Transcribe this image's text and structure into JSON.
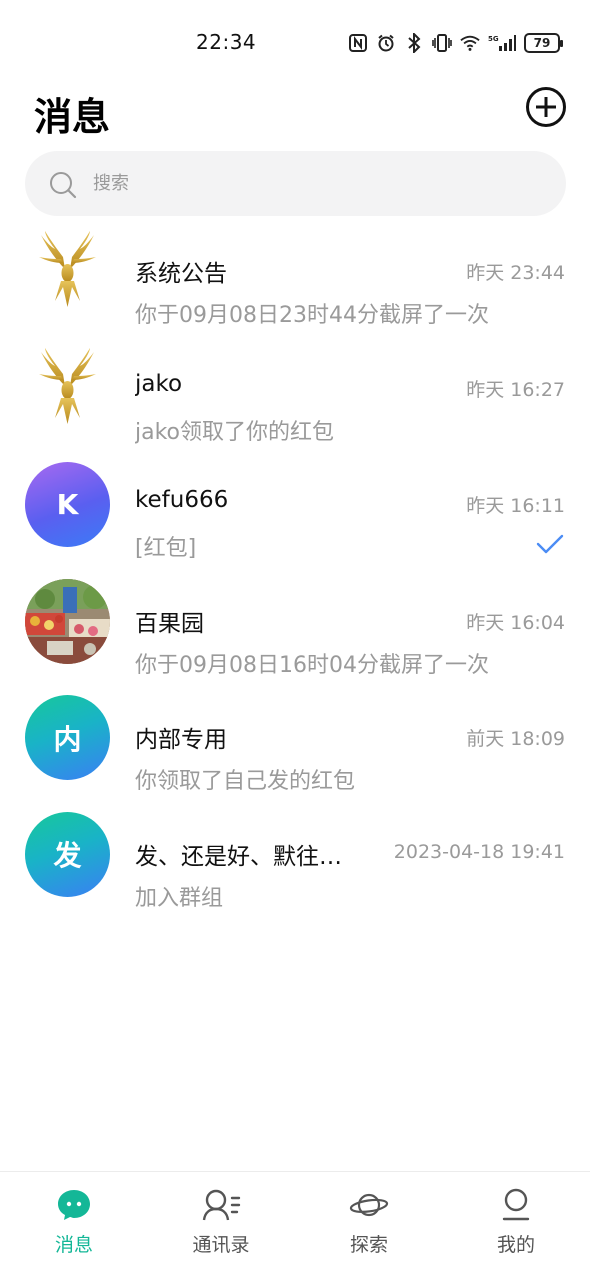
{
  "status_bar": {
    "time": "22:34",
    "battery": "79",
    "icons": [
      "nfc-icon",
      "alarm-icon",
      "bluetooth-icon",
      "vibrate-icon",
      "wifi-icon",
      "signal-5g-icon",
      "battery-icon"
    ]
  },
  "header": {
    "title": "消息",
    "add_icon": "plus-circle-icon"
  },
  "search": {
    "placeholder": "搜索"
  },
  "chats": [
    {
      "name": "系统公告",
      "time": "昨天 23:44",
      "preview": "你于09月08日23时44分截屏了一次",
      "avatar_type": "eagle-logo"
    },
    {
      "name": "jako",
      "time": "昨天 16:27",
      "preview": "jako领取了你的红包",
      "avatar_type": "eagle-logo"
    },
    {
      "name": "kefu666",
      "time": "昨天 16:11",
      "preview": "[红包]",
      "avatar_letter": "K",
      "read_status": "check-icon",
      "accent": "#4b8cf5"
    },
    {
      "name": "百果园",
      "time": "昨天 16:04",
      "preview": "你于09月08日16时04分截屏了一次",
      "avatar_type": "photo"
    },
    {
      "name": "内部专用",
      "time": "前天 18:09",
      "preview": "你领取了自己发的红包",
      "avatar_letter": "内"
    },
    {
      "name": "发、还是好、默往…",
      "time": "2023-04-18 19:41",
      "preview": "加入群组",
      "avatar_letter": "发"
    }
  ],
  "tabbar": {
    "tabs": [
      {
        "label": "消息",
        "icon": "chat-bubble-icon",
        "active": true
      },
      {
        "label": "通讯录",
        "icon": "contacts-icon",
        "active": false
      },
      {
        "label": "探索",
        "icon": "planet-icon",
        "active": false
      },
      {
        "label": "我的",
        "icon": "profile-icon",
        "active": false
      }
    ],
    "active_color": "#14b797"
  }
}
